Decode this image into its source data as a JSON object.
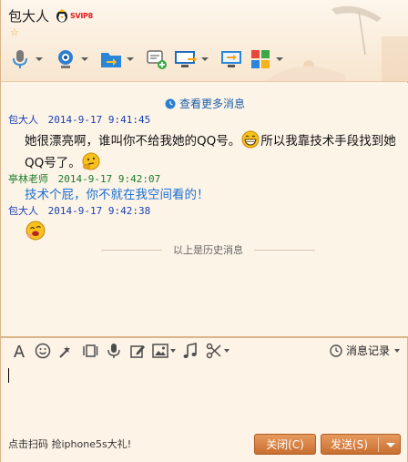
{
  "window": {
    "title": "包大人",
    "badge_text": "SVIP8",
    "star": "☆"
  },
  "toolbar": {
    "buttons": [
      {
        "icon": "microphone-icon"
      },
      {
        "icon": "webcam-icon"
      },
      {
        "icon": "file-transfer-icon"
      },
      {
        "icon": "add-app-icon"
      },
      {
        "icon": "remote-desktop-icon"
      },
      {
        "icon": "screen-share-icon"
      },
      {
        "icon": "apps-grid-icon"
      }
    ]
  },
  "messages": {
    "more_link": "查看更多消息",
    "items": [
      {
        "sender": "包大人",
        "time": "2014-9-17 9:41:45",
        "text_before": "她很漂亮啊，谁叫你不给我她的QQ号。",
        "text_after": "所以我靠技术手段找到她QQ号了。",
        "emoji": [
          "grin-emoji",
          "thinking-emoji"
        ]
      },
      {
        "sender": "亭林老师",
        "time": "2014-9-17 9:42:07",
        "text": "技术个屁，你不就在我空间看的！"
      },
      {
        "sender": "包大人",
        "time": "2014-9-17 9:42:38",
        "emoji": [
          "laugh-emoji"
        ]
      }
    ],
    "history_divider": "以上是历史消息"
  },
  "input_toolbar": {
    "icons": [
      "font-icon",
      "emoji-icon",
      "shake-icon",
      "screenshot-icon",
      "voice-icon",
      "edit-icon",
      "image-icon",
      "music-icon",
      "scissors-icon"
    ],
    "record_label": "消息记录"
  },
  "bottom": {
    "promo": "点击扫码 抢iphone5s大礼!",
    "close_label": "关闭(C)",
    "send_label": "发送(S)"
  },
  "colors": {
    "accent": "#c86e31",
    "self_name": "#1a3fb0",
    "other_name": "#1a7a2b",
    "other_text": "#1c6fd1",
    "link": "#1d5fa8"
  }
}
